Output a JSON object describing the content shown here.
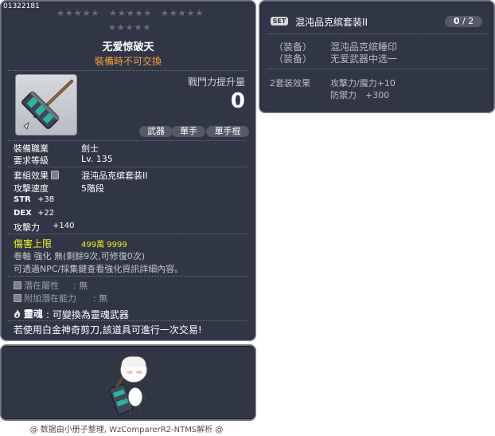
{
  "tooltip": {
    "item_id": "01322181",
    "stars_row1": [
      "★★★★★",
      "★★★★★",
      "★★★★★"
    ],
    "stars_row2": "★★★★★",
    "name": "无爱惊破天",
    "trade_notice": "裝備時不可交換",
    "icon": "hammer-weapon-icon",
    "power_label": "戰鬥力提升量",
    "power_value": "0",
    "tags": [
      "武器",
      "單手",
      "單手棍"
    ],
    "job_label": "裝備職業",
    "job_value": "劍士",
    "level_label": "要求等級",
    "level_value": "Lv. 135",
    "set_label": "套組效果",
    "set_value": "混沌品克缤套装II",
    "speed_label": "攻擊速度",
    "speed_value": "5階段",
    "stats": [
      {
        "name": "STR",
        "value": "+38"
      },
      {
        "name": "DEX",
        "value": "+22"
      }
    ],
    "attack_label": "攻擊力",
    "attack_value": "+140",
    "damage_cap_label": "傷害上限",
    "damage_cap_value": "499萬 9999",
    "scroll_text": "卷軸 強化 無(剩餘9次,可修復0次)",
    "hint_text": "可透過NPC/採集鍵查看強化資訊詳細內容。",
    "potential_label": "潛在屬性",
    "potential_value": ": 無",
    "bonus_label": "附加潛在能力",
    "bonus_value": ": 無",
    "soul_label": "靈魂",
    "soul_value": ": 可變換為靈魂武器",
    "scissors_text": "若使用白金神奇剪刀,該道具可進行一次交易!"
  },
  "set_panel": {
    "badge": "SET",
    "title": "混沌品克缤套装II",
    "count_current": "0",
    "count_sep": "/",
    "count_total": "2",
    "members": [
      {
        "type": "（装备）",
        "name": "混沌品克缤睡印"
      },
      {
        "type": "（装备）",
        "name": "无爱武器中选一"
      }
    ],
    "effect_label": "2套装效果",
    "effects": [
      "攻擊力/魔力+10",
      "防禦力　+300"
    ]
  },
  "footer": "@ 数据由小册子整理, WzComparerR2-NTMS解析 @",
  "colors": {
    "panel_bg": "#303646",
    "panel_border": "#6f7482",
    "trade_notice": "#ff9c3a",
    "highlight": "#f2f21b"
  }
}
